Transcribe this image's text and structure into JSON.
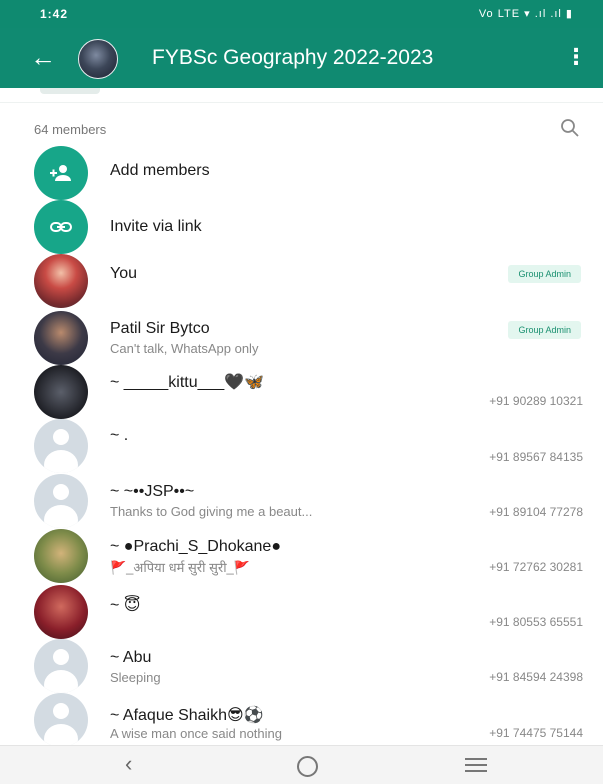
{
  "status_bar": {
    "time": "1:42",
    "indicators": "Vo LTE ▾ .ıl .ıl ▮"
  },
  "header": {
    "back_icon": "arrow-left-icon",
    "title": "FYBSc Geography 2022-2023",
    "menu_icon": "more-vert-icon"
  },
  "members": {
    "count_label": "64 members",
    "search_icon": "search-icon",
    "actions": [
      {
        "label": "Add members",
        "icon": "add-person-icon"
      },
      {
        "label": "Invite via link",
        "icon": "link-icon"
      }
    ],
    "list": [
      {
        "name": "You",
        "status": "",
        "phone": "",
        "badge": "Group Admin",
        "avatar": "photo1"
      },
      {
        "name": "Patil Sir Bytco",
        "status": "Can't talk, WhatsApp only",
        "phone": "",
        "badge": "Group Admin",
        "avatar": "photo2"
      },
      {
        "name": "~ _____kittu___🖤🦋",
        "status": "",
        "phone": "+91 90289 10321",
        "badge": "",
        "avatar": "photo3"
      },
      {
        "name": "~ .",
        "status": "",
        "phone": "+91 89567 84135",
        "badge": "",
        "avatar": "blank"
      },
      {
        "name": "~ ~••JSP••~",
        "status": "Thanks to God giving me a beaut...",
        "phone": "+91 89104 77278",
        "badge": "",
        "avatar": "blank"
      },
      {
        "name": "~ ●Prachi_S_Dhokane●",
        "status": "🚩_अपिया धर्म सुरी सुरी_🚩",
        "phone": "+91 72762 30281",
        "badge": "",
        "avatar": "photo4"
      },
      {
        "name": "~ 😇",
        "status": "",
        "phone": "+91 80553 65551",
        "badge": "",
        "avatar": "photo5"
      },
      {
        "name": "~ Abu",
        "status": "Sleeping",
        "phone": "+91 84594 24398",
        "badge": "",
        "avatar": "blank"
      },
      {
        "name": "~ Afaque Shaikh😎⚽",
        "status": "A wise man once said nothing",
        "phone": "+91 74475 75144",
        "badge": "",
        "avatar": "blank"
      }
    ]
  },
  "nav_bar": {
    "back_icon": "nav-back-icon",
    "home_icon": "nav-home-icon",
    "recents_icon": "nav-recents-icon"
  },
  "colors": {
    "primary": "#108a71",
    "accent": "#17a689",
    "badge_bg": "#e3f6ef"
  }
}
